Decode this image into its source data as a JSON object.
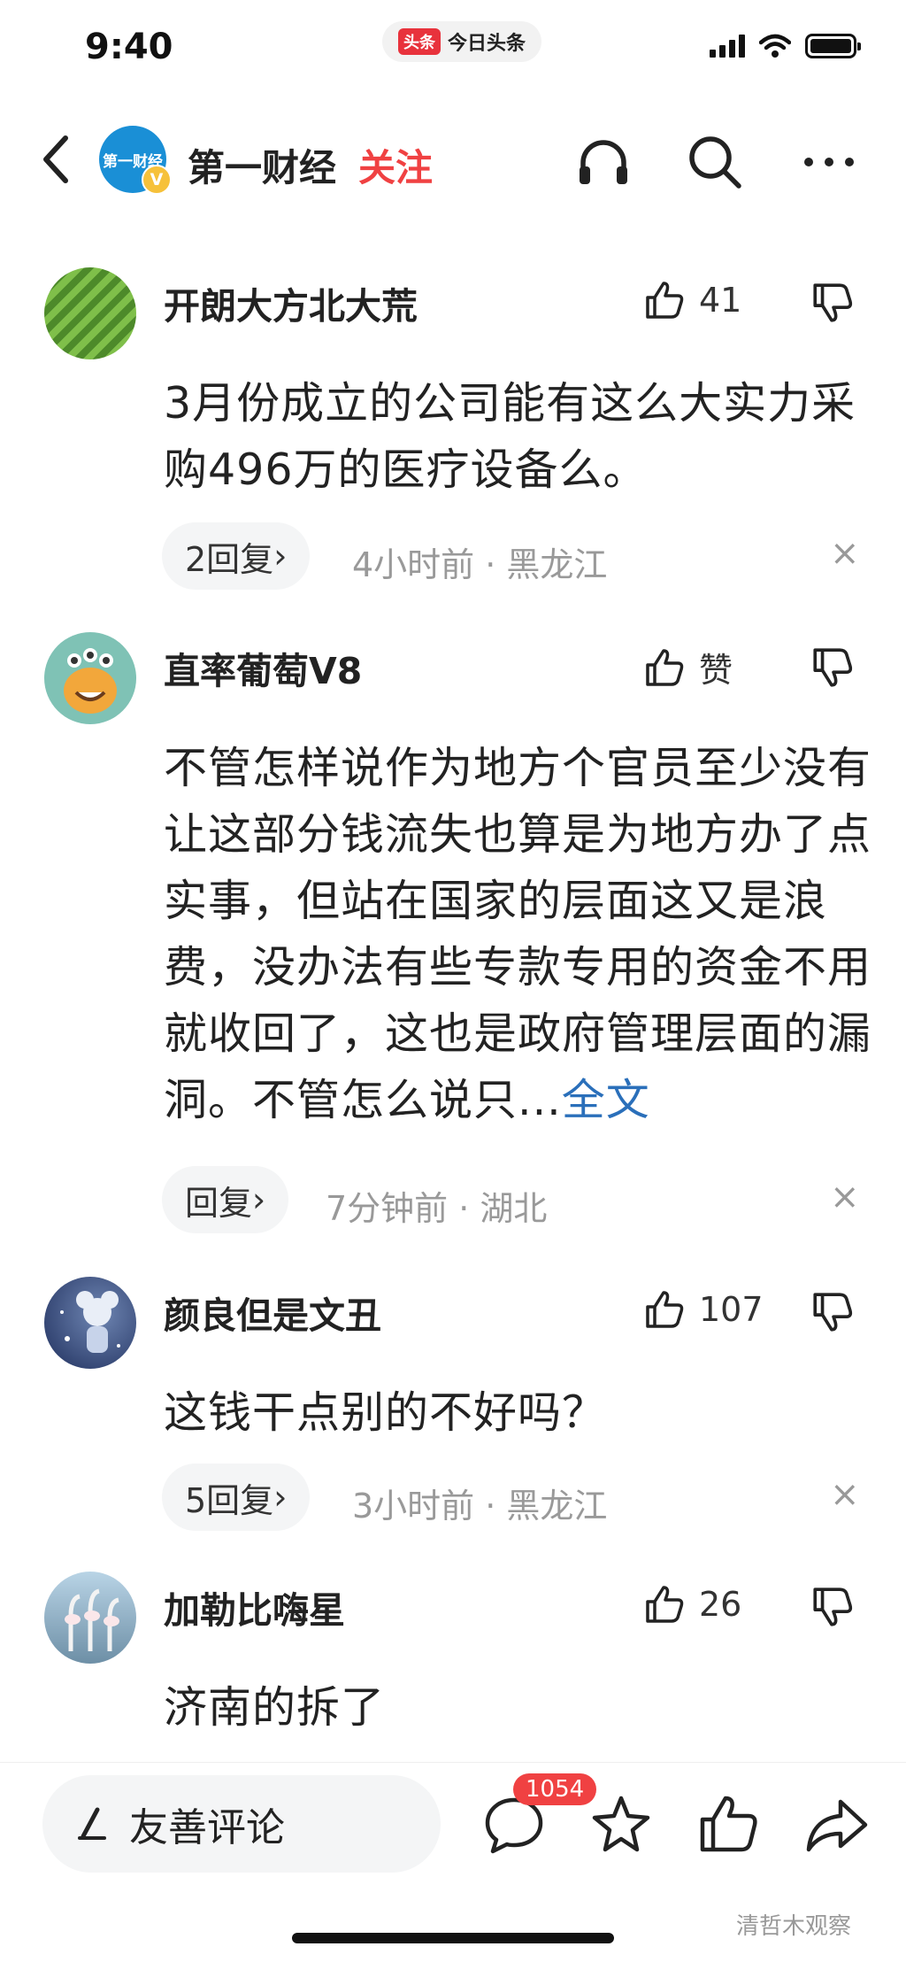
{
  "status_bar": {
    "time": "9:40",
    "app_badge_logo": "头条",
    "app_badge_name": "今日头条"
  },
  "nav": {
    "account_name": "第一财经",
    "avatar_text": "第一财经",
    "verified_badge": "V",
    "follow_label": "关注"
  },
  "comments": [
    {
      "username": "开朗大方北大荒",
      "likes": "41",
      "text": "3月份成立的公司能有这么大实力采购496万的医疗设备么。",
      "more_label": "",
      "reply_label": "2回复",
      "meta": "4小时前 · 黑龙江"
    },
    {
      "username": "直率葡萄V8",
      "likes": "赞",
      "text": "不管怎样说作为地方个官员至少没有让这部分钱流失也算是为地方办了点实事，但站在国家的层面这又是浪费，没办法有些专款专用的资金不用就收回了，这也是政府管理层面的漏洞。不管怎么说只...",
      "more_label": "全文",
      "reply_label": "回复",
      "meta": "7分钟前 · 湖北"
    },
    {
      "username": "颜良但是文丑",
      "likes": "107",
      "text": "这钱干点别的不好吗？",
      "more_label": "",
      "reply_label": "5回复",
      "meta": "3小时前 · 黑龙江"
    },
    {
      "username": "加勒比嗨星",
      "likes": "26",
      "text": "济南的拆了",
      "more_label": "",
      "reply_label": "",
      "meta": ""
    }
  ],
  "icons": {
    "chevron": "›",
    "close": "×"
  },
  "bottom_bar": {
    "input_label": "友善评论",
    "comment_count": "1054"
  },
  "watermark": "清哲木观察",
  "colors": {
    "accent_red": "#f04142",
    "link_blue": "#2a6fba",
    "meta_gray": "#999999"
  }
}
